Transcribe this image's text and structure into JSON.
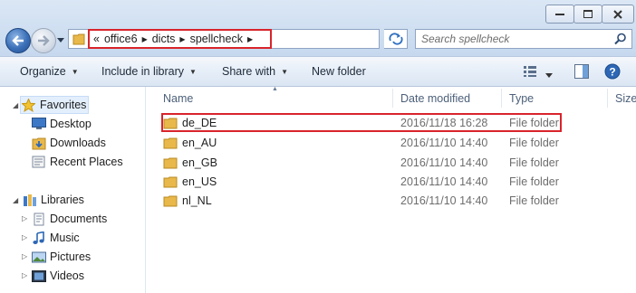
{
  "window": {
    "controls": [
      "minimize",
      "maximize",
      "close"
    ]
  },
  "address": {
    "overflow_glyph": "«",
    "crumbs": [
      "office6",
      "dicts",
      "spellcheck"
    ]
  },
  "search": {
    "placeholder": "Search spellcheck"
  },
  "toolbar": {
    "organize": "Organize",
    "include_in_library": "Include in library",
    "share_with": "Share with",
    "new_folder": "New folder"
  },
  "nav": {
    "favorites": {
      "label": "Favorites",
      "items": [
        "Desktop",
        "Downloads",
        "Recent Places"
      ]
    },
    "libraries": {
      "label": "Libraries",
      "items": [
        "Documents",
        "Music",
        "Pictures",
        "Videos"
      ]
    }
  },
  "columns": {
    "name": "Name",
    "date_modified": "Date modified",
    "type": "Type",
    "size": "Size"
  },
  "files": [
    {
      "name": "de_DE",
      "date": "2016/11/18 16:28",
      "type": "File folder",
      "highlighted": true
    },
    {
      "name": "en_AU",
      "date": "2016/11/10 14:40",
      "type": "File folder",
      "highlighted": false
    },
    {
      "name": "en_GB",
      "date": "2016/11/10 14:40",
      "type": "File folder",
      "highlighted": false
    },
    {
      "name": "en_US",
      "date": "2016/11/10 14:40",
      "type": "File folder",
      "highlighted": false
    },
    {
      "name": "nl_NL",
      "date": "2016/11/10 14:40",
      "type": "File folder",
      "highlighted": false
    }
  ],
  "colors": {
    "highlight_border": "#d9242b",
    "folder": "#e8b84a",
    "accent": "#3a6fb7"
  }
}
